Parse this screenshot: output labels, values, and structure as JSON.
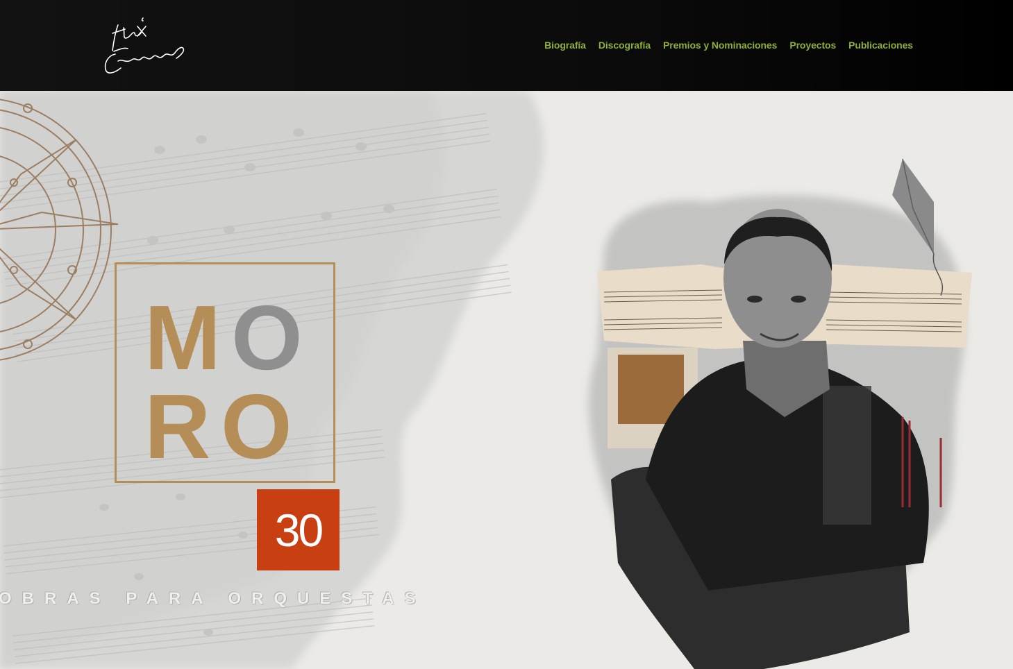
{
  "header": {
    "logo_text": "Félix Cárdenas",
    "nav": [
      "Biografía",
      "Discografía",
      "Premios y Nominaciones",
      "Proyectos",
      "Publicaciones"
    ]
  },
  "hero": {
    "title_letters": [
      "M",
      "O",
      "R",
      "O"
    ],
    "badge": "30",
    "tagline": "OBRAS PARA ORQUESTAS"
  },
  "colors": {
    "nav_text": "#8cb038",
    "gold": "#b58d57",
    "grey": "#8f8f8f",
    "badge": "#c83f12"
  }
}
